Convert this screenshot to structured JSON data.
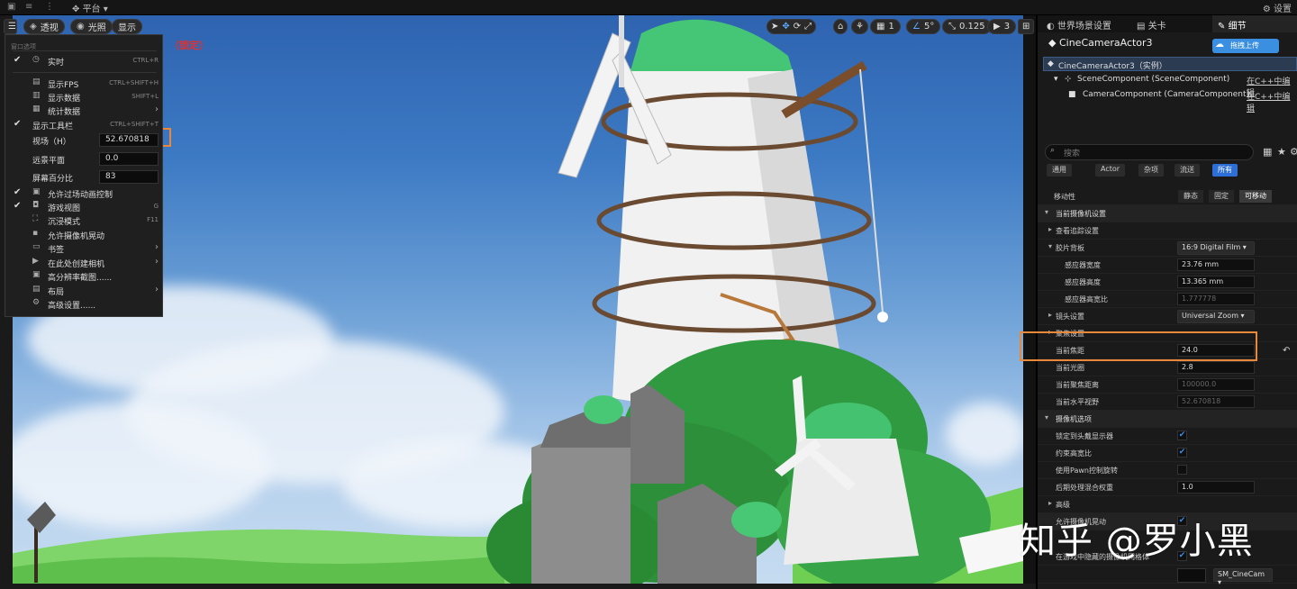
{
  "topbar": {
    "mode_menu": "平台",
    "settings": "设置"
  },
  "viewport_toolbar": {
    "menu_icon": "hamburger-icon",
    "perspective": "透视",
    "lighting": "光照",
    "show": "显示",
    "locked": "（锁定）",
    "grid_value": "1",
    "angle_value": "5°",
    "scale_value": "0.125",
    "camera_speed": "3"
  },
  "viewport_menu": {
    "header": "窗口选项",
    "items": [
      {
        "label": "实时",
        "shortcut": "CTRL+R",
        "checked": true,
        "icon": "clock-icon"
      },
      {
        "label": "显示FPS",
        "shortcut": "CTRL+SHIFT+H",
        "checked": false,
        "icon": "fps-icon"
      },
      {
        "label": "显示数据",
        "shortcut": "SHIFT+L",
        "checked": false,
        "icon": "data-icon"
      },
      {
        "label": "统计数据",
        "shortcut": "",
        "checked": false,
        "icon": "stats-icon",
        "submenu": true
      },
      {
        "label": "显示工具栏",
        "shortcut": "CTRL+SHIFT+T",
        "checked": true,
        "icon": ""
      }
    ],
    "fields": [
      {
        "label": "视场（H）",
        "value": "52.670818"
      },
      {
        "label": "远景平面",
        "value": "0.0"
      },
      {
        "label": "屏幕百分比",
        "value": "83"
      }
    ],
    "items2": [
      {
        "label": "允许过场动画控制",
        "shortcut": "",
        "checked": true,
        "icon": "film-icon"
      },
      {
        "label": "游戏视图",
        "shortcut": "G",
        "checked": true,
        "icon": "gamepad-icon"
      },
      {
        "label": "沉浸模式",
        "shortcut": "F11",
        "checked": false,
        "icon": "fullscreen-icon"
      },
      {
        "label": "允许摄像机晃动",
        "shortcut": "",
        "checked": false,
        "icon": "camera-shake-icon"
      },
      {
        "label": "书签",
        "shortcut": "",
        "checked": false,
        "icon": "bookmark-icon",
        "submenu": true
      },
      {
        "label": "在此处创建相机",
        "shortcut": "",
        "checked": false,
        "icon": "camera-icon",
        "submenu": true
      },
      {
        "label": "高分辨率截图......",
        "shortcut": "",
        "checked": false,
        "icon": "screenshot-icon"
      },
      {
        "label": "布局",
        "shortcut": "",
        "checked": false,
        "icon": "layout-icon",
        "submenu": true
      },
      {
        "label": "高级设置......",
        "shortcut": "",
        "checked": false,
        "icon": "gear-icon"
      }
    ]
  },
  "panel": {
    "tabs": [
      "世界场景设置",
      "关卡",
      "细节"
    ],
    "actor_title": "CineCameraActor3",
    "upload_button": "拖拽上传",
    "tree": [
      {
        "label": "CineCameraActor3（实例）",
        "edit": ""
      },
      {
        "label": "SceneComponent (SceneComponent)",
        "edit": "在C++中编辑"
      },
      {
        "label": "CameraComponent (CameraComponent)",
        "edit": "在C++中编辑"
      }
    ],
    "search_placeholder": "搜索",
    "filters": [
      "通用",
      "Actor",
      "杂项",
      "流送",
      "所有"
    ],
    "mobility_label": "移动性",
    "mobility_options": [
      "静态",
      "固定",
      "可移动"
    ],
    "sections": {
      "current_camera": "当前摄像机设置",
      "lookat": "查看追踪设置",
      "filmback": "胶片背板",
      "filmback_value": "16:9 Digital Film",
      "sensor_width_label": "感应器宽度",
      "sensor_width": "23.76 mm",
      "sensor_height_label": "感应器高度",
      "sensor_height": "13.365 mm",
      "sensor_ratio_label": "感应器高宽比",
      "sensor_ratio": "1.777778",
      "lens": "镜头设置",
      "lens_value": "Universal Zoom",
      "focus": "聚焦设置",
      "focal_length_label": "当前焦距",
      "focal_length": "24.0",
      "aperture_label": "当前光圈",
      "aperture": "2.8",
      "focus_distance_label": "当前聚焦距离",
      "focus_distance": "100000.0",
      "hfov_label": "当前水平视野",
      "hfov": "52.670818",
      "camera_options": "摄像机选项",
      "lock_hmd": "锁定到头戴显示器",
      "constrain_ratio": "约束高宽比",
      "use_pawn": "使用Pawn控制旋转",
      "pp_weight_label": "后期处理混合权重",
      "pp_weight": "1.0",
      "advanced": "高级",
      "allow_camera_shake": "允许摄像机晃动",
      "hide_mesh": "在游戏中隐藏的摄像机网格体",
      "mesh_value": "SM_CineCam"
    }
  },
  "watermark": "知乎 @罗小黑",
  "colors": {
    "accent_blue": "#2d6fd6",
    "highlight_orange": "#e8893a",
    "locked_red": "#e03030"
  }
}
